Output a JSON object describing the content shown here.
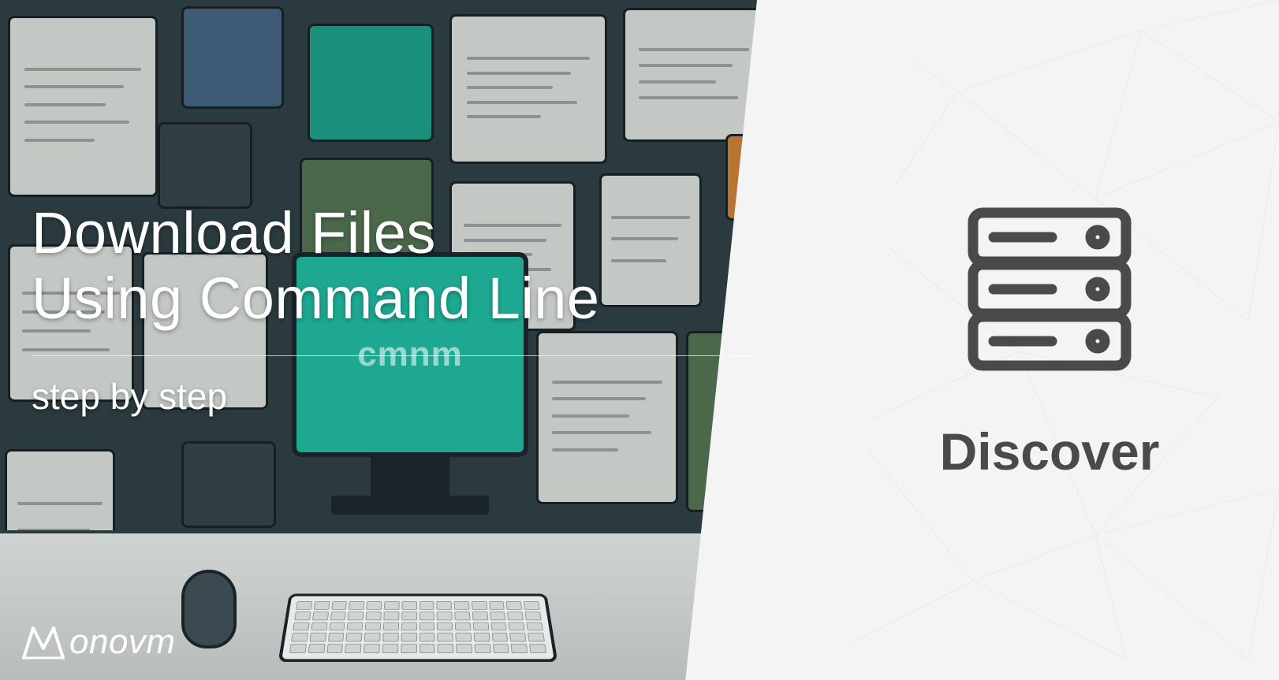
{
  "left": {
    "title_line1": "Download Files",
    "title_line2": "Using Command Line",
    "subtitle": "step by step",
    "monitor_text": "cmnm"
  },
  "right": {
    "label": "Discover",
    "icon_name": "server-rack-icon"
  },
  "brand": {
    "name": "Monovm",
    "text_part": "onovm"
  },
  "colors": {
    "teal": "#1ea891",
    "dark": "#2a3a3f",
    "right_bg": "#f4f4f4",
    "icon_stroke": "#4a4a4a"
  }
}
